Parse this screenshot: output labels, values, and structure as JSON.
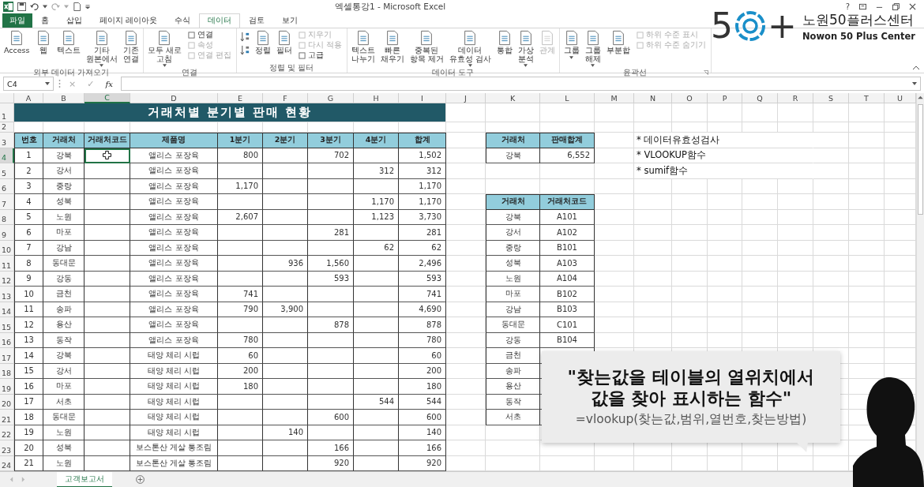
{
  "window": {
    "title": "엑셀통강1 - Microsoft Excel",
    "help": "?"
  },
  "logo": {
    "digit": "5",
    "plus": "+",
    "name": "노원50플러스센터",
    "english": "Nowon 50 Plus Center"
  },
  "tabs": [
    {
      "label": "파일",
      "kind": "file",
      "selected": false
    },
    {
      "label": "홈",
      "kind": "tab",
      "selected": false
    },
    {
      "label": "삽입",
      "kind": "tab",
      "selected": false
    },
    {
      "label": "페이지 레이아웃",
      "kind": "tab",
      "selected": false
    },
    {
      "label": "수식",
      "kind": "tab",
      "selected": false
    },
    {
      "label": "데이터",
      "kind": "tab",
      "selected": true
    },
    {
      "label": "검토",
      "kind": "tab",
      "selected": false
    },
    {
      "label": "보기",
      "kind": "tab",
      "selected": false
    }
  ],
  "ribbon": [
    {
      "label": "외부 데이터 가져오기",
      "launcher": false,
      "items": [
        {
          "kind": "large",
          "lines": [
            "Access"
          ],
          "dropdown": false,
          "disabled": false
        },
        {
          "kind": "large",
          "lines": [
            "웹"
          ],
          "dropdown": false,
          "disabled": false
        },
        {
          "kind": "large",
          "lines": [
            "텍스트"
          ],
          "dropdown": false,
          "disabled": false
        },
        {
          "kind": "large",
          "lines": [
            "기타",
            "원본에서"
          ],
          "dropdown": true,
          "disabled": false
        },
        {
          "kind": "large",
          "lines": [
            "기존",
            "연결"
          ],
          "dropdown": false,
          "disabled": false
        }
      ]
    },
    {
      "label": "연결",
      "launcher": false,
      "items": [
        {
          "kind": "large",
          "lines": [
            "모두 새로",
            "고침"
          ],
          "dropdown": true,
          "disabled": false
        },
        {
          "kind": "stack",
          "items": [
            {
              "label": "연결",
              "disabled": false
            },
            {
              "label": "속성",
              "disabled": true
            },
            {
              "label": "연결 편집",
              "disabled": true
            }
          ]
        }
      ]
    },
    {
      "label": "정렬 및 필터",
      "launcher": false,
      "items": [
        {
          "kind": "sort"
        },
        {
          "kind": "large",
          "lines": [
            "정렬"
          ],
          "dropdown": false,
          "disabled": false
        },
        {
          "kind": "large",
          "lines": [
            "필터"
          ],
          "dropdown": false,
          "disabled": false
        },
        {
          "kind": "stack",
          "items": [
            {
              "label": "지우기",
              "disabled": true
            },
            {
              "label": "다시 적용",
              "disabled": true
            },
            {
              "label": "고급",
              "disabled": false
            }
          ]
        }
      ]
    },
    {
      "label": "데이터 도구",
      "launcher": false,
      "items": [
        {
          "kind": "large",
          "lines": [
            "텍스트",
            "나누기"
          ],
          "dropdown": false,
          "disabled": false
        },
        {
          "kind": "large",
          "lines": [
            "빠른",
            "채우기"
          ],
          "dropdown": false,
          "disabled": false
        },
        {
          "kind": "large",
          "lines": [
            "중복된",
            "항목 제거"
          ],
          "dropdown": false,
          "disabled": false
        },
        {
          "kind": "large",
          "lines": [
            "데이터",
            "유효성 검사"
          ],
          "dropdown": true,
          "disabled": false
        },
        {
          "kind": "large",
          "lines": [
            "통합"
          ],
          "dropdown": false,
          "disabled": false
        },
        {
          "kind": "large",
          "lines": [
            "가상",
            "분석"
          ],
          "dropdown": true,
          "disabled": false
        },
        {
          "kind": "large",
          "lines": [
            "관계"
          ],
          "dropdown": false,
          "disabled": true
        }
      ]
    },
    {
      "label": "윤곽선",
      "launcher": true,
      "items": [
        {
          "kind": "large",
          "lines": [
            "그룹"
          ],
          "dropdown": true,
          "disabled": false
        },
        {
          "kind": "large",
          "lines": [
            "그룹",
            "해제"
          ],
          "dropdown": true,
          "disabled": false
        },
        {
          "kind": "large",
          "lines": [
            "부분합"
          ],
          "dropdown": false,
          "disabled": false
        },
        {
          "kind": "stack",
          "items": [
            {
              "label": "하위 수준 표시",
              "disabled": true
            },
            {
              "label": "하위 수준 숨기기",
              "disabled": true
            }
          ]
        }
      ]
    }
  ],
  "formula_bar": {
    "name_box": "C4",
    "cancel": "×",
    "enter": "✓",
    "function": "fx"
  },
  "sheet": {
    "columns": [
      {
        "label": "A",
        "selected": false
      },
      {
        "label": "B",
        "selected": false
      },
      {
        "label": "C",
        "selected": true
      },
      {
        "label": "D",
        "selected": false
      },
      {
        "label": "E",
        "selected": false
      },
      {
        "label": "F",
        "selected": false
      },
      {
        "label": "G",
        "selected": false
      },
      {
        "label": "H",
        "selected": false
      },
      {
        "label": "I",
        "selected": false
      },
      {
        "label": "J",
        "selected": false
      },
      {
        "label": "K",
        "selected": false
      },
      {
        "label": "L",
        "selected": false
      },
      {
        "label": "M",
        "selected": false
      },
      {
        "label": "N",
        "selected": false
      },
      {
        "label": "O",
        "selected": false
      },
      {
        "label": "P",
        "selected": false
      },
      {
        "label": "Q",
        "selected": false
      },
      {
        "label": "R",
        "selected": false
      },
      {
        "label": "S",
        "selected": false
      },
      {
        "label": "T",
        "selected": false
      },
      {
        "label": "U",
        "selected": false
      }
    ],
    "rows": [
      {
        "label": "1",
        "selected": false
      },
      {
        "label": "2",
        "selected": false
      },
      {
        "label": "3",
        "selected": false
      },
      {
        "label": "4",
        "selected": true
      },
      {
        "label": "5",
        "selected": false
      },
      {
        "label": "6",
        "selected": false
      },
      {
        "label": "7",
        "selected": false
      },
      {
        "label": "8",
        "selected": false
      },
      {
        "label": "9",
        "selected": false
      },
      {
        "label": "10",
        "selected": false
      },
      {
        "label": "11",
        "selected": false
      },
      {
        "label": "12",
        "selected": false
      },
      {
        "label": "13",
        "selected": false
      },
      {
        "label": "14",
        "selected": false
      },
      {
        "label": "15",
        "selected": false
      },
      {
        "label": "16",
        "selected": false
      },
      {
        "label": "17",
        "selected": false
      },
      {
        "label": "18",
        "selected": false
      },
      {
        "label": "19",
        "selected": false
      },
      {
        "label": "20",
        "selected": false
      },
      {
        "label": "21",
        "selected": false
      },
      {
        "label": "22",
        "selected": false
      },
      {
        "label": "23",
        "selected": false
      },
      {
        "label": "24",
        "selected": false
      }
    ],
    "title": "거래처별 분기별 판매 현황"
  },
  "sales_table": {
    "columns": [
      "번호",
      "거래처",
      "거래처코드",
      "제품명",
      "1분기",
      "2분기",
      "3분기",
      "4분기",
      "합계"
    ],
    "rows": [
      {
        "no": "1",
        "client": "강북",
        "product": "앨리스 포장육",
        "q1": "800",
        "q3": "702",
        "total": "1,502",
        "selected": true
      },
      {
        "no": "2",
        "client": "강서",
        "product": "앨리스 포장육",
        "q4": "312",
        "total": "312",
        "selected": false
      },
      {
        "no": "3",
        "client": "중랑",
        "product": "앨리스 포장육",
        "q1": "1,170",
        "total": "1,170",
        "selected": false
      },
      {
        "no": "4",
        "client": "성북",
        "product": "앨리스 포장육",
        "q4": "1,170",
        "total": "1,170",
        "selected": false
      },
      {
        "no": "5",
        "client": "노원",
        "product": "앨리스 포장육",
        "q1": "2,607",
        "q4": "1,123",
        "total": "3,730",
        "selected": false
      },
      {
        "no": "6",
        "client": "마포",
        "product": "앨리스 포장육",
        "q3": "281",
        "total": "281",
        "selected": false
      },
      {
        "no": "7",
        "client": "강남",
        "product": "앨리스 포장육",
        "q4": "62",
        "total": "62",
        "selected": false
      },
      {
        "no": "8",
        "client": "동대문",
        "product": "앨리스 포장육",
        "q2": "936",
        "q3": "1,560",
        "total": "2,496",
        "selected": false
      },
      {
        "no": "9",
        "client": "강동",
        "product": "앨리스 포장육",
        "q3": "593",
        "total": "593",
        "selected": false
      },
      {
        "no": "10",
        "client": "금천",
        "product": "앨리스 포장육",
        "q1": "741",
        "total": "741",
        "selected": false
      },
      {
        "no": "11",
        "client": "송파",
        "product": "앨리스 포장육",
        "q1": "790",
        "q2": "3,900",
        "total": "4,690",
        "selected": false
      },
      {
        "no": "12",
        "client": "용산",
        "product": "앨리스 포장육",
        "q3": "878",
        "total": "878",
        "selected": false
      },
      {
        "no": "13",
        "client": "동작",
        "product": "앨리스 포장육",
        "q1": "780",
        "total": "780",
        "selected": false
      },
      {
        "no": "14",
        "client": "강북",
        "product": "태양 체리 시럽",
        "q1": "60",
        "total": "60",
        "selected": false
      },
      {
        "no": "15",
        "client": "강서",
        "product": "태양 체리 시럽",
        "q1": "200",
        "total": "200",
        "selected": false
      },
      {
        "no": "16",
        "client": "마포",
        "product": "태양 체리 시럽",
        "q1": "180",
        "total": "180",
        "selected": false
      },
      {
        "no": "17",
        "client": "서초",
        "product": "태양 체리 시럽",
        "q4": "544",
        "total": "544",
        "selected": false
      },
      {
        "no": "18",
        "client": "동대문",
        "product": "태양 체리 시럽",
        "q3": "600",
        "total": "600",
        "selected": false
      },
      {
        "no": "19",
        "client": "노원",
        "product": "태양 체리 시럽",
        "q2": "140",
        "total": "140",
        "selected": false
      },
      {
        "no": "20",
        "client": "성북",
        "product": "보스톤산 게살 통조림",
        "q3": "166",
        "total": "166",
        "selected": false
      },
      {
        "no": "21",
        "client": "노원",
        "product": "보스톤산 게살 통조림",
        "q3": "920",
        "total": "920",
        "selected": false
      }
    ]
  },
  "summary_table": {
    "columns": [
      "거래처",
      "판매합계"
    ],
    "rows": [
      {
        "client": "강북",
        "total": "6,552"
      }
    ]
  },
  "lookup_table": {
    "columns": [
      "거래처",
      "거래처코드"
    ],
    "rows": [
      {
        "client": "강북",
        "code": "A101"
      },
      {
        "client": "강서",
        "code": "A102"
      },
      {
        "client": "중랑",
        "code": "B101"
      },
      {
        "client": "성북",
        "code": "A103"
      },
      {
        "client": "노원",
        "code": "A104"
      },
      {
        "client": "마포",
        "code": "B102"
      },
      {
        "client": "강남",
        "code": "B103"
      },
      {
        "client": "동대문",
        "code": "C101"
      },
      {
        "client": "강동",
        "code": "B104"
      },
      {
        "client": "금천"
      },
      {
        "client": "송파"
      },
      {
        "client": "용산"
      },
      {
        "client": "동작"
      },
      {
        "client": "서초"
      }
    ]
  },
  "notes": [
    "* 데이터유효성검사",
    "* VLOOKUP함수",
    "* sumif함수"
  ],
  "callout": {
    "quote": "\"찾는값을 테이블의 열위치에서\n값을 찾아 표시하는 함수\"",
    "formula": "=vlookup(찾는값,범위,열번호,찾는방법)"
  },
  "sheet_tabs": [
    {
      "label": "고객보고서",
      "selected": true
    }
  ]
}
